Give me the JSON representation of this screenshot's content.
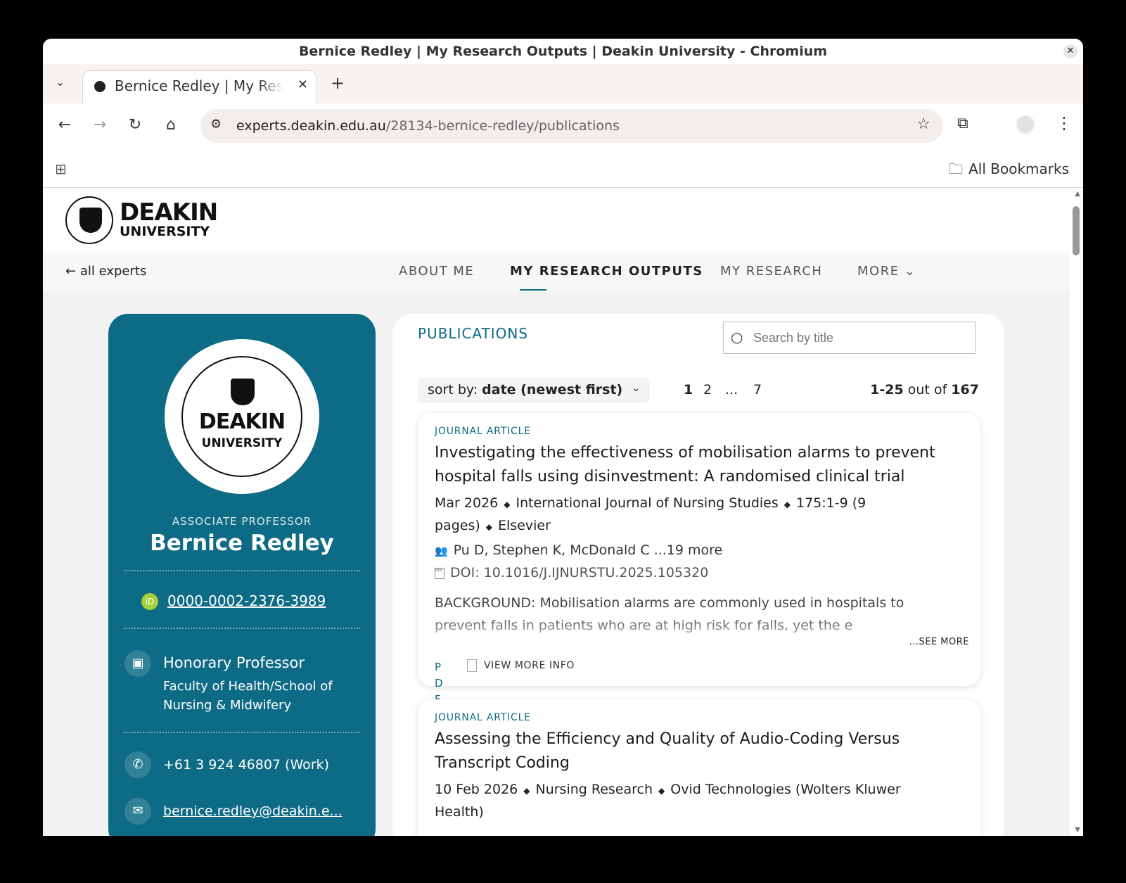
{
  "window": {
    "title": "Bernice Redley | My Research Outputs | Deakin University - Chromium",
    "close_glyph": "✕"
  },
  "tab": {
    "title": "Bernice Redley | My Research Outputs | Deakin University",
    "close_glyph": "✕",
    "new_tab_glyph": "+",
    "dropdown_glyph": "⌄"
  },
  "toolbar": {
    "back_glyph": "←",
    "forward_glyph": "→",
    "reload_glyph": "↻",
    "home_glyph": "⌂",
    "url_domain": "experts.deakin.edu.au",
    "url_path": "/28134-bernice-redley/publications",
    "star_glyph": "☆",
    "extensions_glyph": "⧉",
    "menu_glyph": "⋮",
    "site_info_glyph": "⚙"
  },
  "bookmarks": {
    "all_bookmarks": "All Bookmarks",
    "folder_glyph": "🗀",
    "apps_glyph": "⊞"
  },
  "site": {
    "logo_line1": "DEAKIN",
    "logo_line2": "UNIVERSITY",
    "back_link": "all experts",
    "back_arrow": "←",
    "nav": [
      "ABOUT ME",
      "MY RESEARCH OUTPUTS",
      "MY RESEARCH",
      "MORE"
    ],
    "more_chevron": "⌄"
  },
  "profile": {
    "avatar_line1": "DEAKIN",
    "avatar_line2": "UNIVERSITY",
    "role": "ASSOCIATE PROFESSOR",
    "name": "Bernice Redley",
    "orcid_badge": "iD",
    "orcid": "0000-0002-2376-3989",
    "position_title": "Honorary Professor",
    "position_unit": "Faculty of Health/School of Nursing & Midwifery",
    "phone": "+61 3 924 46807 (Work)",
    "email": "bernice.redley@deakin.e...",
    "badge_icon": "▣",
    "phone_icon": "✆",
    "email_icon": "✉"
  },
  "publications": {
    "heading": "PUBLICATIONS",
    "search_placeholder": "Search by title",
    "search_icon": "○",
    "sort_label": "sort by:",
    "sort_value": "date (newest first)",
    "sort_chevron": "⌄",
    "pages": [
      "1",
      "2",
      "...",
      "7"
    ],
    "range": "1-25",
    "range_mid": "out of",
    "total": "167",
    "items": [
      {
        "type": "JOURNAL ARTICLE",
        "title": "Investigating the effectiveness of mobilisation alarms to prevent hospital falls using disinvestment: A randomised clinical trial",
        "date": "Mar 2026",
        "journal": "International Journal of Nursing Studies",
        "pages": "175:1-9 (9 pages)",
        "publisher": "Elsevier",
        "authors": "Pu D, Stephen K, McDonald C ...19 more",
        "doi": "DOI: 10.1016/J.IJNURSTU.2025.105320",
        "abstract": "BACKGROUND: Mobilisation alarms are commonly used in hospitals to prevent falls in patients who are at high risk for falls, yet the e",
        "see_more": "...SEE MORE",
        "pdf": "PDF",
        "view_more": "VIEW MORE INFO"
      },
      {
        "type": "JOURNAL ARTICLE",
        "title": "Assessing the Efficiency and Quality of Audio-Coding Versus Transcript Coding",
        "date": "10 Feb 2026",
        "journal": "Nursing Research",
        "publisher": "Ovid Technologies (Wolters Kluwer Health)"
      }
    ],
    "separator": "◆",
    "authors_icon": "👥",
    "doi_icon": "DOI"
  },
  "scrollbar": {
    "up_glyph": "▲",
    "down_glyph": "▼"
  }
}
